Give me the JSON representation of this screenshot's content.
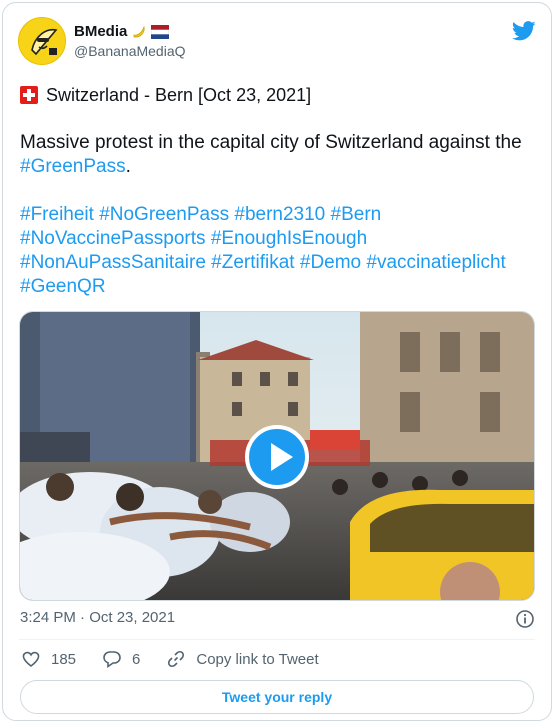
{
  "author": {
    "display_name": "BMedia",
    "handle": "@BananaMediaQ",
    "icons": [
      "banana-emoji-icon",
      "netherlands-flag-icon"
    ]
  },
  "brand": {
    "logo": "twitter-bird-icon",
    "accent": "#1d9bf0"
  },
  "tweet": {
    "location_flag": "swiss-flag-icon",
    "location_line": "Switzerland - Bern [Oct 23, 2021]",
    "body_prefix": "Massive protest in the capital city of Switzerland against the ",
    "body_tag": "#GreenPass",
    "body_suffix": ".",
    "hashtag_lines": [
      [
        "#Freiheit",
        "#NoGreenPass",
        "#bern2310",
        "#Bern"
      ],
      [
        "#NoVaccinePassports",
        "#EnoughIsEnough"
      ],
      [
        "#NonAuPassSanitaire",
        "#Zertifikat",
        "#Demo",
        "#vaccinatieplicht"
      ],
      [
        "#GeenQR"
      ]
    ]
  },
  "media": {
    "type": "video",
    "play_icon": "play-icon"
  },
  "meta": {
    "timestamp": "3:24 PM · Oct 23, 2021",
    "info_icon": "info-icon"
  },
  "actions": {
    "likes": "185",
    "replies": "6",
    "copy_link_label": "Copy link to Tweet"
  },
  "reply_button_label": "Tweet your reply",
  "colors": {
    "text": "#0f1419",
    "secondary": "#536471",
    "link": "#1d9bf0",
    "border": "#cfd9de"
  }
}
